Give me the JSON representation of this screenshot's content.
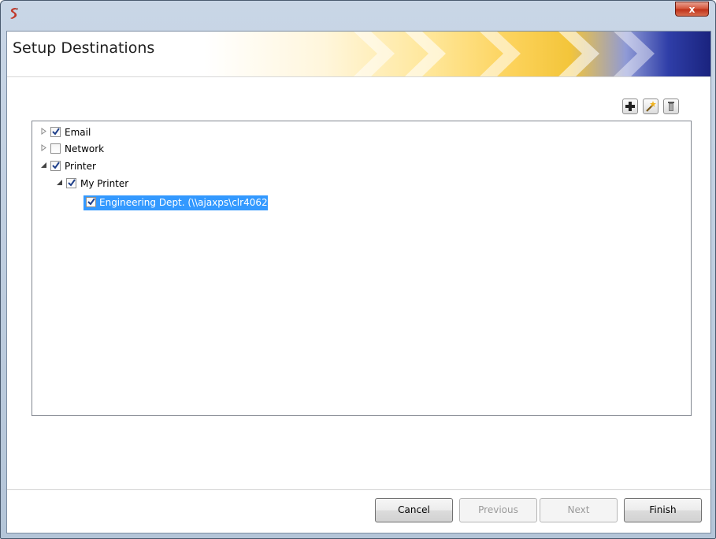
{
  "window": {
    "close_glyph": "x"
  },
  "header": {
    "title": "Setup Destinations"
  },
  "toolbar": {
    "add_icon": "plus-icon",
    "edit_icon": "magic-wand-icon",
    "delete_icon": "trash-icon"
  },
  "tree": {
    "nodes": [
      {
        "label": "Email",
        "checked": true,
        "expanded": false
      },
      {
        "label": "Network",
        "checked": false,
        "expanded": false
      },
      {
        "label": "Printer",
        "checked": true,
        "expanded": true
      },
      {
        "label": "My Printer",
        "checked": true,
        "expanded": true
      },
      {
        "label": "Engineering Dept. (\\\\ajaxps\\clr4062)",
        "checked": true,
        "selected": true
      }
    ]
  },
  "footer": {
    "cancel_label": "Cancel",
    "previous_label": "Previous",
    "next_label": "Next",
    "finish_label": "Finish"
  },
  "colors": {
    "selection": "#3399ff",
    "banner_dark": "#1a237e",
    "banner_gold": "#fcd25a"
  }
}
